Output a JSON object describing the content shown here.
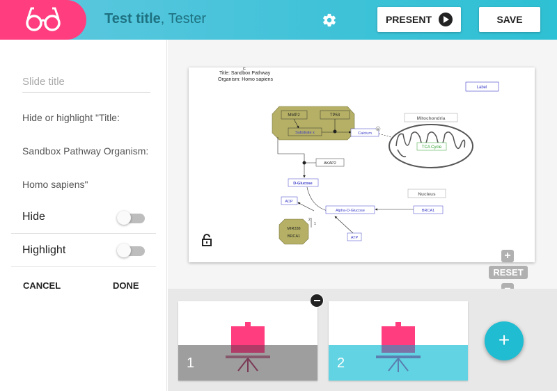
{
  "header": {
    "title_bold": "Test title",
    "title_rest": ", Tester",
    "present_label": "PRESENT",
    "save_label": "SAVE",
    "logo_icon": "glasses-icon",
    "settings_icon": "gear-icon",
    "colors": {
      "accent": "#ff3d7f",
      "teal": "#3fc2d8"
    }
  },
  "editor": {
    "slide_title_placeholder": "Slide title",
    "hint_line1": "Hide or highlight \"Title:",
    "hint_line2": "Sandbox Pathway Organism:",
    "hint_line3": "Homo sapiens\"",
    "hide_label": "Hide",
    "highlight_label": "Highlight",
    "cancel_label": "CANCEL",
    "done_label": "DONE"
  },
  "diagram": {
    "title_line1": "Title: Sandbox Pathway",
    "title_line2": "Organism: Homo sapiens",
    "marker": "E",
    "nodes": {
      "label": "Label",
      "mmp2": "MMP2",
      "tp53": "TP53",
      "substrate": "Substrate x",
      "calcium": "Calcium",
      "mitochondria": "Mitochondria",
      "tca": "TCA Cycle",
      "akap2": "AKAP2",
      "dglucose": "D-Glucose",
      "adp": "ADP",
      "alpha": "Alpha-D-Glucose",
      "brca1_right": "BRCA1",
      "nucleus": "Nucleus",
      "mir338": "MIR338",
      "brca1_left": "BRCA1",
      "atp": "ATP"
    },
    "edge_labels": {
      "a": "2",
      "b": "1",
      "c": "B"
    }
  },
  "zoom": {
    "plus": "+",
    "reset": "RESET",
    "minus": "−"
  },
  "slides": [
    {
      "number": "1",
      "band_color": "#9e9e9e"
    },
    {
      "number": "2",
      "band_color": "#61d3e2"
    }
  ],
  "fab_label": "+"
}
